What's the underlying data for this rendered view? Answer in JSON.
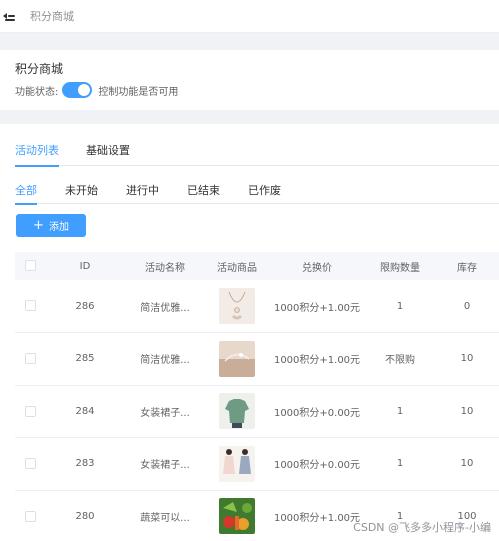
{
  "topbar": {
    "breadcrumb": "积分商城"
  },
  "settings_card": {
    "title": "积分商城",
    "status_label": "功能状态:",
    "switch_on": true,
    "switch_hint": "控制功能是否可用"
  },
  "tabs_primary": [
    {
      "label": "活动列表",
      "active": true
    },
    {
      "label": "基础设置",
      "active": false
    }
  ],
  "tabs_status": [
    {
      "label": "全部",
      "active": true
    },
    {
      "label": "未开始",
      "active": false
    },
    {
      "label": "进行中",
      "active": false
    },
    {
      "label": "已结束",
      "active": false
    },
    {
      "label": "已作废",
      "active": false
    }
  ],
  "add_button": {
    "label": "添加",
    "icon": "plus-icon"
  },
  "table": {
    "headers": [
      "",
      "ID",
      "活动名称",
      "活动商品",
      "兑换价",
      "限购数量",
      "库存"
    ],
    "rows": [
      {
        "id": "286",
        "name": "简洁优雅...",
        "image": "necklace",
        "price": "1000积分+1.00元",
        "limit": "1",
        "stock": "0"
      },
      {
        "id": "285",
        "name": "简洁优雅...",
        "image": "bracelet",
        "price": "1000积分+1.00元",
        "limit": "不限购",
        "stock": "10"
      },
      {
        "id": "284",
        "name": "女装裙子...",
        "image": "green-shirt",
        "price": "1000积分+0.00元",
        "limit": "1",
        "stock": "10"
      },
      {
        "id": "283",
        "name": "女装裙子...",
        "image": "dresses",
        "price": "1000积分+0.00元",
        "limit": "1",
        "stock": "10"
      },
      {
        "id": "280",
        "name": "蔬菜可以...",
        "image": "vegetables",
        "price": "1000积分+1.00元",
        "limit": "1",
        "stock": "100"
      }
    ]
  },
  "watermark": "CSDN @飞多多小程序-小编",
  "colors": {
    "accent": "#409eff",
    "header_bg": "#f5f7fa",
    "page_bg": "#f0f2f5"
  }
}
